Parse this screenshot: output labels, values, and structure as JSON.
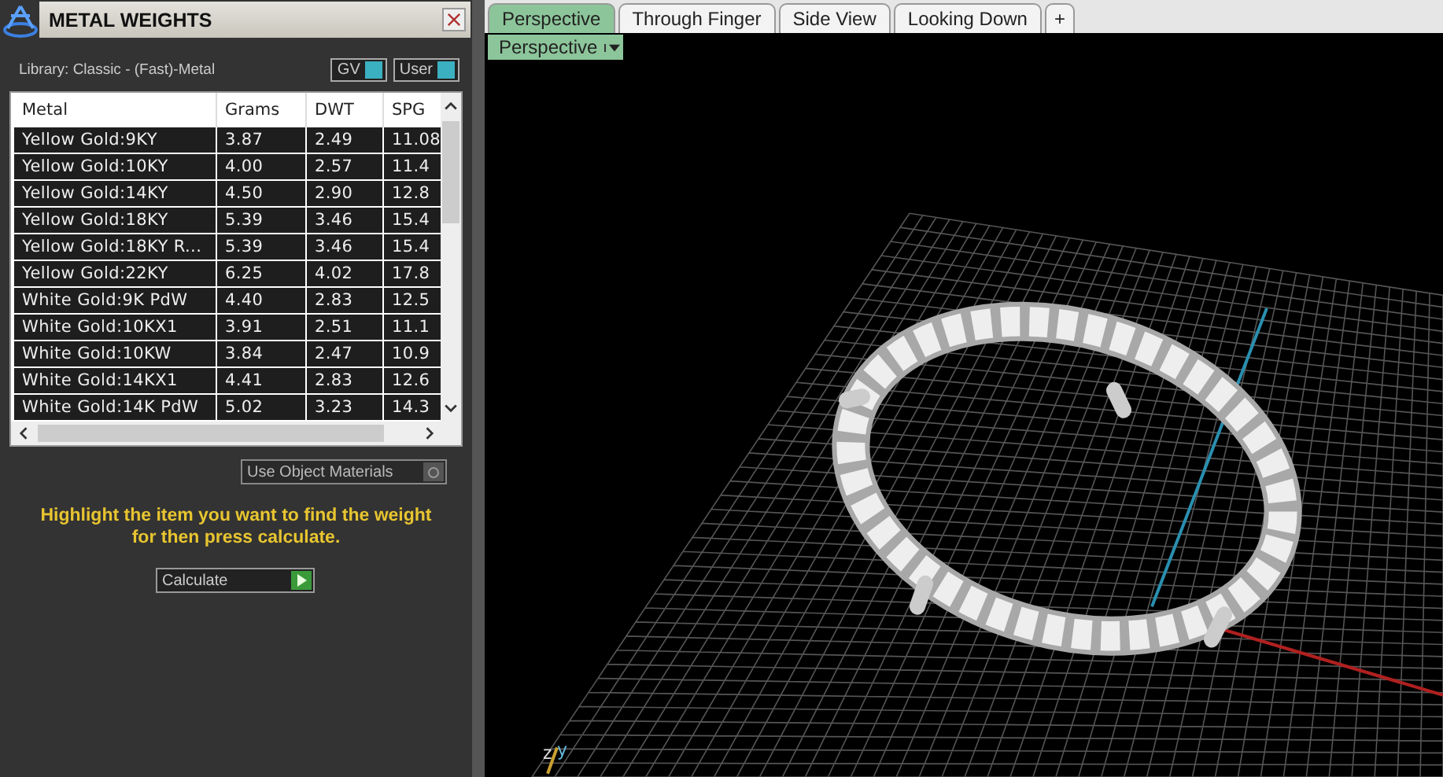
{
  "panel": {
    "title": "METAL WEIGHTS",
    "library": "Library: Classic - (Fast)-Metal",
    "toggles": [
      {
        "label": "GV",
        "on": true
      },
      {
        "label": "User",
        "on": true
      }
    ]
  },
  "table": {
    "columns": [
      "Metal",
      "Grams",
      "DWT",
      "SPG"
    ],
    "rows": [
      {
        "cells": [
          "Yellow Gold:9KY",
          "3.87",
          "2.49",
          "11.08"
        ]
      },
      {
        "cells": [
          "Yellow Gold:10KY",
          "4.00",
          "2.57",
          "11.4"
        ]
      },
      {
        "cells": [
          "Yellow Gold:14KY",
          "4.50",
          "2.90",
          "12.8"
        ]
      },
      {
        "cells": [
          "Yellow Gold:18KY",
          "5.39",
          "3.46",
          "15.4"
        ]
      },
      {
        "cells": [
          "Yellow Gold:18KY R...",
          "5.39",
          "3.46",
          "15.4"
        ]
      },
      {
        "cells": [
          "Yellow Gold:22KY",
          "6.25",
          "4.02",
          "17.8"
        ]
      },
      {
        "cells": [
          "White Gold:9K PdW",
          "4.40",
          "2.83",
          "12.5"
        ]
      },
      {
        "cells": [
          "White Gold:10KX1",
          "3.91",
          "2.51",
          "11.1"
        ]
      },
      {
        "cells": [
          "White Gold:10KW",
          "3.84",
          "2.47",
          "10.9"
        ]
      },
      {
        "cells": [
          "White Gold:14KX1",
          "4.41",
          "2.83",
          "12.6"
        ]
      },
      {
        "cells": [
          "White Gold:14K PdW",
          "5.02",
          "3.23",
          "14.3"
        ]
      }
    ]
  },
  "use_object_materials": {
    "label": "Use Object Materials",
    "checked": false
  },
  "hint": "Highlight the item you want to find the weight for then press calculate.",
  "calculate": {
    "label": "Calculate"
  },
  "viewport": {
    "tabs": [
      {
        "label": "Perspective",
        "selected": true
      },
      {
        "label": "Through Finger",
        "selected": false
      },
      {
        "label": "Side View",
        "selected": false
      },
      {
        "label": "Looking Down",
        "selected": false
      }
    ],
    "add_tab": "+",
    "view_dropdown": "Perspective",
    "axis_labels": [
      "z",
      "y"
    ]
  }
}
